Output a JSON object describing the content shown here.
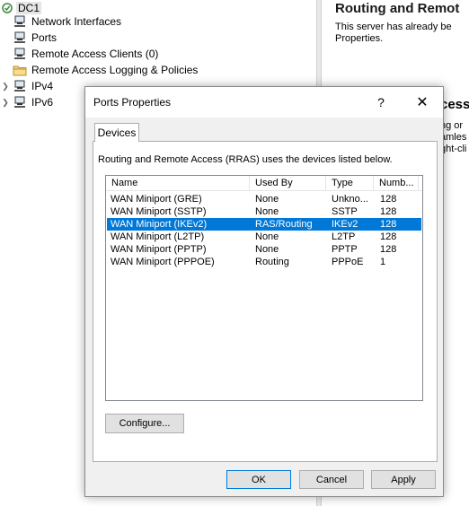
{
  "tree": {
    "root": "DC1",
    "items": [
      {
        "label": "Network Interfaces",
        "icon": "network-icon"
      },
      {
        "label": "Ports",
        "icon": "ports-icon"
      },
      {
        "label": "Remote Access Clients (0)",
        "icon": "clients-icon"
      },
      {
        "label": "Remote Access Logging & Policies",
        "icon": "folder-icon"
      },
      {
        "label": "IPv4",
        "icon": "ip-icon"
      },
      {
        "label": "IPv6",
        "icon": "ip-icon"
      }
    ]
  },
  "right_pane": {
    "title": "Routing and Remot",
    "line1": "This server has already be",
    "line2": "Properties.",
    "subtitle_fragment": "cess",
    "frag1": "ng or",
    "frag2": "amles",
    "frag3": "ght-cli"
  },
  "dialog": {
    "title": "Ports Properties",
    "help_glyph": "?",
    "close_glyph": "✕",
    "tab": "Devices",
    "description": "Routing and Remote Access (RRAS) uses the devices listed below.",
    "columns": [
      "Name",
      "Used By",
      "Type",
      "Numb..."
    ],
    "rows": [
      {
        "name": "WAN Miniport (GRE)",
        "used_by": "None",
        "type": "Unkno...",
        "number": "128",
        "selected": false
      },
      {
        "name": "WAN Miniport (SSTP)",
        "used_by": "None",
        "type": "SSTP",
        "number": "128",
        "selected": false
      },
      {
        "name": "WAN Miniport (IKEv2)",
        "used_by": "RAS/Routing",
        "type": "IKEv2",
        "number": "128",
        "selected": true
      },
      {
        "name": "WAN Miniport (L2TP)",
        "used_by": "None",
        "type": "L2TP",
        "number": "128",
        "selected": false
      },
      {
        "name": "WAN Miniport (PPTP)",
        "used_by": "None",
        "type": "PPTP",
        "number": "128",
        "selected": false
      },
      {
        "name": "WAN Miniport (PPPOE)",
        "used_by": "Routing",
        "type": "PPPoE",
        "number": "1",
        "selected": false
      }
    ],
    "configure_label": "Configure...",
    "ok_label": "OK",
    "cancel_label": "Cancel",
    "apply_label": "Apply"
  },
  "colors": {
    "selection": "#0078d7",
    "dialog_bg": "#f0f0f0",
    "button_bg": "#e1e1e1"
  }
}
